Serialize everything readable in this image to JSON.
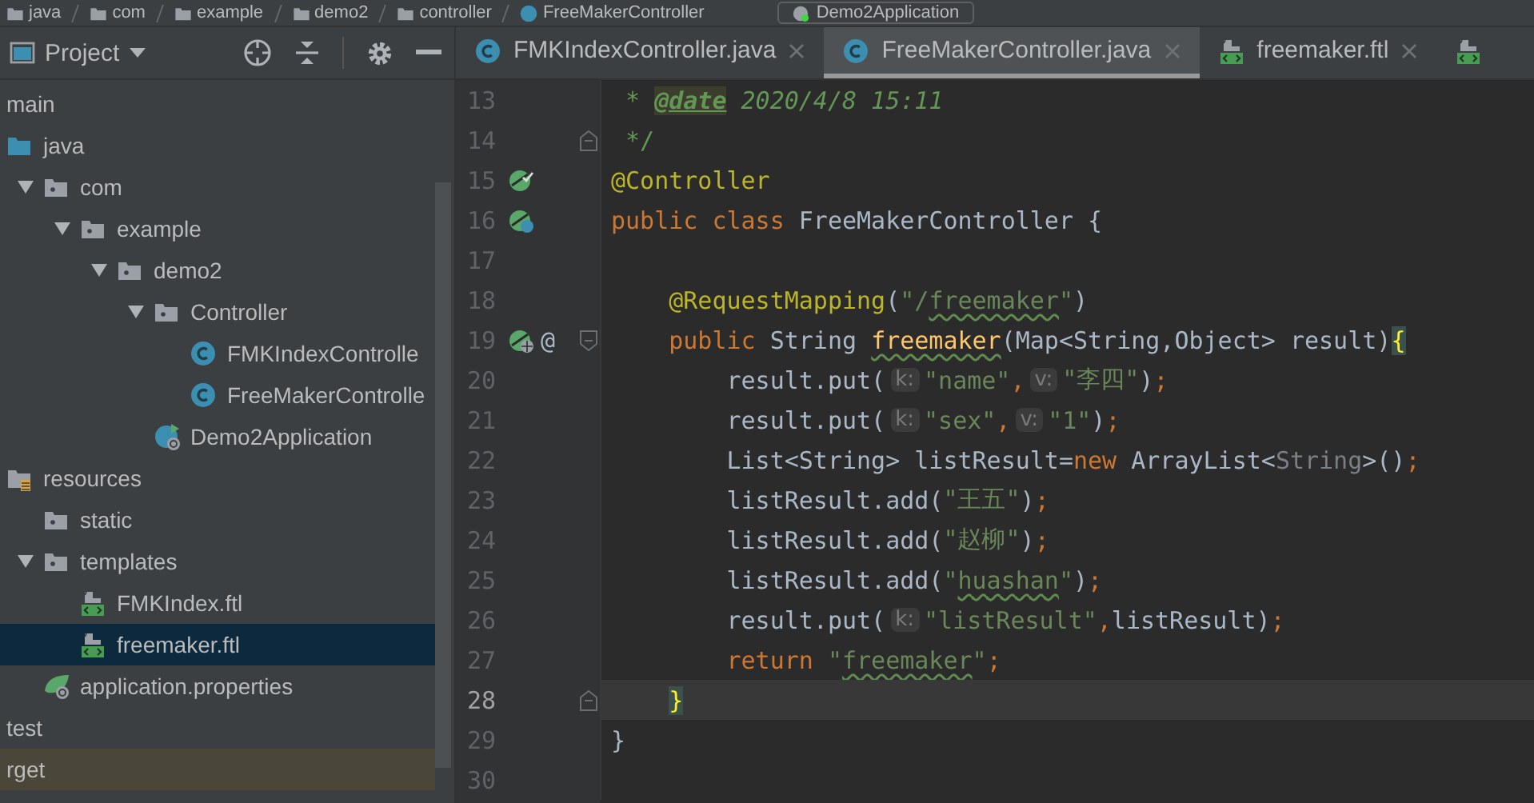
{
  "breadcrumb": {
    "items": [
      {
        "label": "java"
      },
      {
        "label": "com"
      },
      {
        "label": "example"
      },
      {
        "label": "demo2"
      },
      {
        "label": "controller"
      },
      {
        "label": "FreeMakerController",
        "kind": "class"
      }
    ],
    "run_config": "Demo2Application"
  },
  "project_panel": {
    "title": "Project",
    "tree": [
      {
        "label": "main",
        "kind": "none",
        "selected": false,
        "children": [
          {
            "label": "java",
            "kind": "source-folder",
            "selected": false,
            "children": [
              {
                "label": "com",
                "kind": "package",
                "expanded": true,
                "selected": false,
                "children": [
                  {
                    "label": "example",
                    "kind": "package",
                    "expanded": true,
                    "selected": false,
                    "children": [
                      {
                        "label": "demo2",
                        "kind": "package",
                        "expanded": true,
                        "selected": false,
                        "children": [
                          {
                            "label": "Controller",
                            "kind": "package",
                            "expanded": true,
                            "selected": false,
                            "children": [
                              {
                                "label": "FMKIndexControlle",
                                "kind": "class",
                                "selected": false
                              },
                              {
                                "label": "FreeMakerControlle",
                                "kind": "class",
                                "selected": false
                              }
                            ]
                          },
                          {
                            "label": "Demo2Application",
                            "kind": "app",
                            "selected": false
                          }
                        ]
                      }
                    ]
                  }
                ]
              }
            ]
          },
          {
            "label": "resources",
            "kind": "resources-folder",
            "selected": false,
            "children": [
              {
                "label": "static",
                "kind": "package",
                "selected": false
              },
              {
                "label": "templates",
                "kind": "package",
                "expanded": true,
                "selected": false,
                "children": [
                  {
                    "label": "FMKIndex.ftl",
                    "kind": "ftl",
                    "selected": false
                  },
                  {
                    "label": "freemaker.ftl",
                    "kind": "ftl",
                    "selected": true
                  }
                ]
              },
              {
                "label": "application.properties",
                "kind": "properties",
                "selected": false
              }
            ]
          }
        ]
      },
      {
        "label": "test",
        "kind": "none",
        "selected": false
      },
      {
        "label": "rget",
        "kind": "excluded",
        "selected": false
      }
    ]
  },
  "tabs": [
    {
      "label": "FMKIndexController.java",
      "kind": "class",
      "selected": false
    },
    {
      "label": "FreeMakerController.java",
      "kind": "class",
      "selected": true
    },
    {
      "label": "freemaker.ftl",
      "kind": "ftl",
      "selected": false
    },
    {
      "kind": "ftl",
      "selected": false
    }
  ],
  "editor": {
    "lines": [
      {
        "number": "13",
        "current": false,
        "segments": [
          {
            "kind": "comment",
            "text": " * "
          },
          {
            "kind": "doc-tag",
            "text": "@date"
          },
          {
            "kind": "doc",
            "text": " 2020/4/8 15:11"
          }
        ]
      },
      {
        "number": "14",
        "current": false,
        "fold": {
          "kind": "end",
          "expanded": true
        },
        "segments": [
          {
            "kind": "comment",
            "text": " */"
          }
        ]
      },
      {
        "number": "15",
        "current": false,
        "markers": [
          {
            "kind": "bean"
          }
        ],
        "segments": [
          {
            "kind": "annotation",
            "text": "@Controller"
          }
        ]
      },
      {
        "number": "16",
        "current": false,
        "markers": [
          {
            "kind": "bean-class"
          }
        ],
        "segments": [
          {
            "kind": "keyword",
            "text": "public class "
          },
          {
            "kind": "plain",
            "text": "FreeMakerController {"
          }
        ]
      },
      {
        "number": "17",
        "current": false
      },
      {
        "number": "18",
        "current": false,
        "segments": [
          {
            "kind": "annotation",
            "text": "    @RequestMapping"
          },
          {
            "kind": "plain",
            "text": "("
          },
          {
            "kind": "string",
            "text": "\"/"
          },
          {
            "kind": "string-typo",
            "text": "freemaker"
          },
          {
            "kind": "string",
            "text": "\""
          },
          {
            "kind": "plain",
            "text": ")"
          }
        ]
      },
      {
        "number": "19",
        "current": false,
        "fold": {
          "kind": "start",
          "expanded": true
        },
        "markers": [
          {
            "kind": "web"
          },
          {
            "kind": "at",
            "text": "@"
          }
        ],
        "segments": [
          {
            "kind": "keyword",
            "text": "    public "
          },
          {
            "kind": "plain",
            "text": "String "
          },
          {
            "kind": "method",
            "text": "freemaker"
          },
          {
            "kind": "plain",
            "text": "(Map<String,Object> result)"
          },
          {
            "kind": "brace",
            "text": "{"
          }
        ]
      },
      {
        "number": "20",
        "current": false,
        "segments": [
          {
            "kind": "plain",
            "text": "        result.put("
          },
          {
            "kind": "hint",
            "text": "k:"
          },
          {
            "kind": "string",
            "text": "\"name\""
          },
          {
            "kind": "keyword",
            "text": ","
          },
          {
            "kind": "hint",
            "text": "v:"
          },
          {
            "kind": "string",
            "text": "\"李四\""
          },
          {
            "kind": "plain",
            "text": ")"
          },
          {
            "kind": "keyword",
            "text": ";"
          }
        ]
      },
      {
        "number": "21",
        "current": false,
        "segments": [
          {
            "kind": "plain",
            "text": "        result.put("
          },
          {
            "kind": "hint",
            "text": "k:"
          },
          {
            "kind": "string",
            "text": "\"sex\""
          },
          {
            "kind": "keyword",
            "text": ","
          },
          {
            "kind": "hint",
            "text": "v:"
          },
          {
            "kind": "string",
            "text": "\"1\""
          },
          {
            "kind": "plain",
            "text": ")"
          },
          {
            "kind": "keyword",
            "text": ";"
          }
        ]
      },
      {
        "number": "22",
        "current": false,
        "segments": [
          {
            "kind": "plain",
            "text": "        List<String> listResult="
          },
          {
            "kind": "keyword",
            "text": "new"
          },
          {
            "kind": "plain",
            "text": " ArrayList<"
          },
          {
            "kind": "generic",
            "text": "String"
          },
          {
            "kind": "plain",
            "text": ">()"
          },
          {
            "kind": "keyword",
            "text": ";"
          }
        ]
      },
      {
        "number": "23",
        "current": false,
        "segments": [
          {
            "kind": "plain",
            "text": "        listResult.add("
          },
          {
            "kind": "string",
            "text": "\"王五\""
          },
          {
            "kind": "plain",
            "text": ")"
          },
          {
            "kind": "keyword",
            "text": ";"
          }
        ]
      },
      {
        "number": "24",
        "current": false,
        "segments": [
          {
            "kind": "plain",
            "text": "        listResult.add("
          },
          {
            "kind": "string",
            "text": "\"赵柳\""
          },
          {
            "kind": "plain",
            "text": ")"
          },
          {
            "kind": "keyword",
            "text": ";"
          }
        ]
      },
      {
        "number": "25",
        "current": false,
        "segments": [
          {
            "kind": "plain",
            "text": "        listResult.add("
          },
          {
            "kind": "string",
            "text": "\""
          },
          {
            "kind": "string-typo",
            "text": "huashan"
          },
          {
            "kind": "string",
            "text": "\""
          },
          {
            "kind": "plain",
            "text": ")"
          },
          {
            "kind": "keyword",
            "text": ";"
          }
        ]
      },
      {
        "number": "26",
        "current": false,
        "segments": [
          {
            "kind": "plain",
            "text": "        result.put("
          },
          {
            "kind": "hint",
            "text": "k:"
          },
          {
            "kind": "string",
            "text": "\"listResult\""
          },
          {
            "kind": "keyword",
            "text": ","
          },
          {
            "kind": "plain",
            "text": "listResult)"
          },
          {
            "kind": "keyword",
            "text": ";"
          }
        ]
      },
      {
        "number": "27",
        "current": false,
        "segments": [
          {
            "kind": "keyword",
            "text": "        return "
          },
          {
            "kind": "string",
            "text": "\""
          },
          {
            "kind": "string-typo",
            "text": "freemaker"
          },
          {
            "kind": "string",
            "text": "\""
          },
          {
            "kind": "keyword",
            "text": ";"
          }
        ]
      },
      {
        "number": "28",
        "current": true,
        "fold": {
          "kind": "end",
          "expanded": true
        },
        "segments": [
          {
            "kind": "brace",
            "text": "    }"
          }
        ]
      },
      {
        "number": "29",
        "current": false,
        "segments": [
          {
            "kind": "plain",
            "text": "}"
          }
        ]
      },
      {
        "number": "30",
        "current": false
      }
    ]
  }
}
